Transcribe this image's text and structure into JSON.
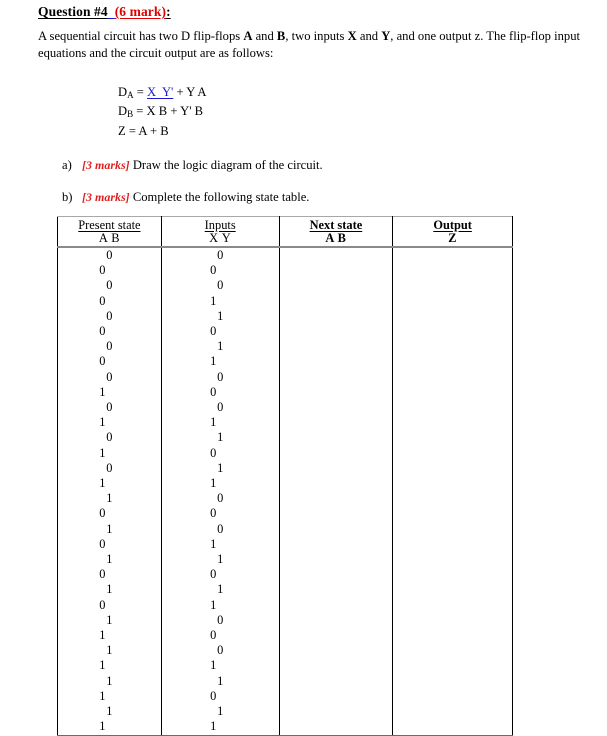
{
  "document": {
    "title": {
      "question_label": "Question #4",
      "gap": "  ",
      "marks": "(6 mark)",
      "colon": ":"
    },
    "intro": {
      "line1_part1": "A sequential circuit has two D flip-flops ",
      "bold_a": "A",
      "line1_part2": " and ",
      "bold_b": "B",
      "line1_part3": ", two inputs ",
      "bold_x": "X",
      "line1_part4": " and ",
      "bold_y": "Y",
      "line1_part5": ", and one output",
      "line2": "z. The flip-flop input equations and the circuit output are as follows:"
    },
    "equations": {
      "eq1": {
        "lhs": "D",
        "sub": "A",
        "eq": " = ",
        "linked": "X  Y'",
        "rhs": " + Y A"
      },
      "eq2": {
        "lhs": "D",
        "sub": "B",
        "eq": " = ",
        "rhs": "X B + Y' B"
      },
      "eq3": {
        "lhs": "Z",
        "eq": " = ",
        "rhs": "A + B"
      }
    },
    "items": [
      {
        "label": "a)",
        "marks": "[3 marks]",
        "text": " Draw the logic diagram of the circuit."
      },
      {
        "label": "b)",
        "marks": "[3 marks]",
        "text": " Complete the following state table."
      }
    ],
    "table": {
      "headers": [
        {
          "top": "Present state",
          "sub": "A   B",
          "bold": false
        },
        {
          "top": "Inputs",
          "sub": "X   Y",
          "bold": false
        },
        {
          "top": "Next state",
          "sub": "A   B",
          "bold": true
        },
        {
          "top": "Output",
          "sub": "Z",
          "bold": true
        }
      ],
      "rows": [
        {
          "present": "0 0",
          "inputs": "0 0",
          "next": "",
          "output": ""
        },
        {
          "present": "0 0",
          "inputs": "0 1",
          "next": "",
          "output": ""
        },
        {
          "present": "0 0",
          "inputs": "1 0",
          "next": "",
          "output": ""
        },
        {
          "present": "0 0",
          "inputs": "1 1",
          "next": "",
          "output": ""
        },
        {
          "present": "0 1",
          "inputs": "0 0",
          "next": "",
          "output": ""
        },
        {
          "present": "0 1",
          "inputs": "0 1",
          "next": "",
          "output": ""
        },
        {
          "present": "0 1",
          "inputs": "1 0",
          "next": "",
          "output": ""
        },
        {
          "present": "0 1",
          "inputs": "1 1",
          "next": "",
          "output": ""
        },
        {
          "present": "1 0",
          "inputs": "0 0",
          "next": "",
          "output": ""
        },
        {
          "present": "1 0",
          "inputs": "0 1",
          "next": "",
          "output": ""
        },
        {
          "present": "1 0",
          "inputs": "1 0",
          "next": "",
          "output": ""
        },
        {
          "present": "1 0",
          "inputs": "1 1",
          "next": "",
          "output": ""
        },
        {
          "present": "1 1",
          "inputs": "0 0",
          "next": "",
          "output": ""
        },
        {
          "present": "1 1",
          "inputs": "0 1",
          "next": "",
          "output": ""
        },
        {
          "present": "1 1",
          "inputs": "1 0",
          "next": "",
          "output": ""
        },
        {
          "present": "1 1",
          "inputs": "1 1",
          "next": "",
          "output": ""
        }
      ]
    },
    "colors": {
      "marks_red": "#e02020",
      "title_red": "#e00000",
      "link_blue": "#1a1acc",
      "text_black": "#000000"
    }
  }
}
